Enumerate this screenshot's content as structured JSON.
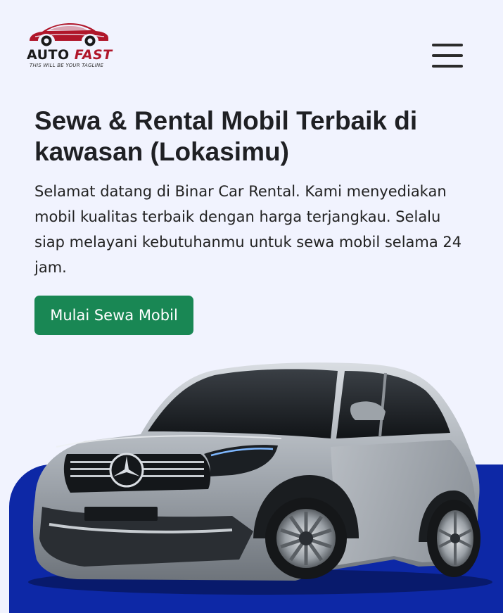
{
  "navbar": {
    "logo": {
      "word1": "AUTO",
      "word2": "FAST",
      "tagline": "THIS WILL BE YOUR TAGLINE",
      "brand_red": "#b0162a"
    },
    "menu_icon": "hamburger-menu-icon"
  },
  "hero": {
    "title": "Sewa & Rental Mobil Terbaik di kawasan (Lokasimu)",
    "description": "Selamat datang di Binar Car Rental. Kami menyediakan mobil kualitas terbaik dengan harga terjangkau. Selalu siap melayani kebutuhanmu untuk sewa mobil selama 24 jam.",
    "cta_label": "Mulai Sewa Mobil",
    "cta_color": "#198754",
    "accent_blue": "#0d28a6",
    "background": "#f1f3fe"
  }
}
